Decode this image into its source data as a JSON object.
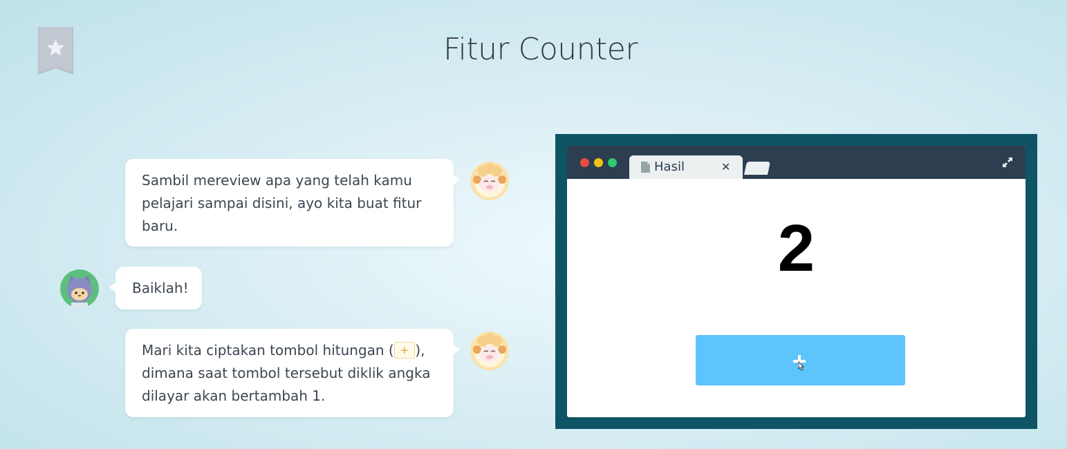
{
  "page": {
    "title": "Fitur Counter"
  },
  "chat": {
    "messages": [
      {
        "speaker": "sheep",
        "text": "Sambil mereview apa yang telah kamu pelajari sampai disini, ayo kita buat fitur baru."
      },
      {
        "speaker": "ninja",
        "text": "Baiklah!"
      },
      {
        "speaker": "sheep",
        "text_before": "Mari kita ciptakan tombol hitungan (",
        "chip": "+",
        "text_after": "), dimana saat tombol tersebut diklik angka dilayar akan bertambah 1."
      }
    ]
  },
  "browser": {
    "tab_title": "Hasil",
    "counter_value": "2",
    "button_icon": "plus-icon"
  },
  "colors": {
    "frame": "#0e5465",
    "chrome": "#2c3e50",
    "button": "#5ec4fc",
    "dot_red": "#e74c3c",
    "dot_yellow": "#f1c40f",
    "dot_green": "#2ecc71"
  }
}
